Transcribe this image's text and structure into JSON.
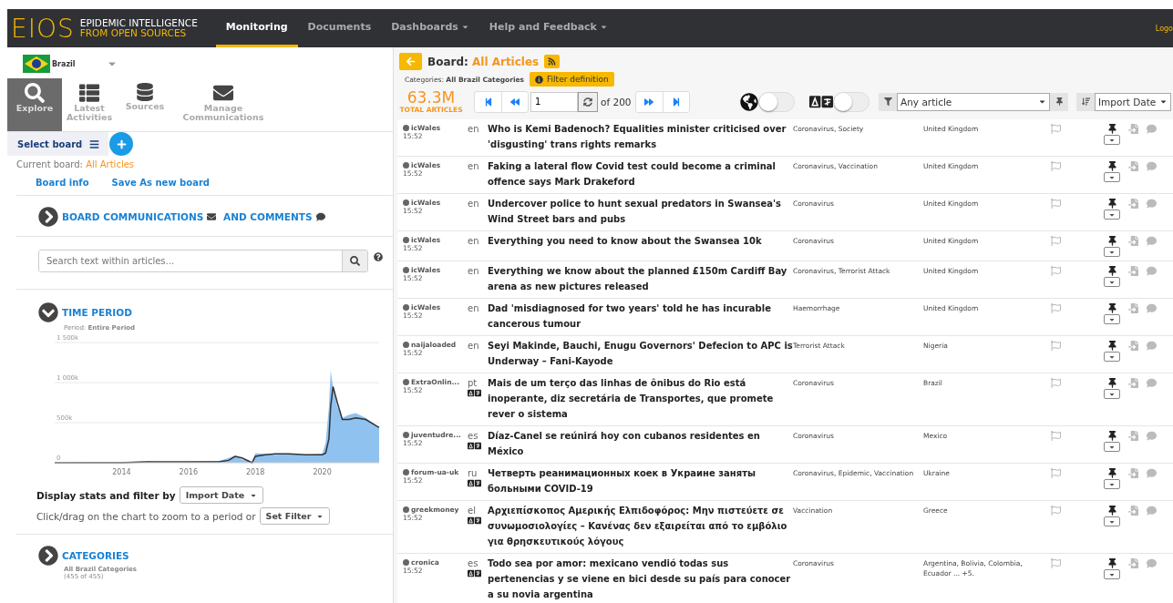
{
  "navbar": {
    "logo": {
      "mark": "EIOS",
      "line1": "EPIDEMIC INTELLIGENCE",
      "line2": "FROM OPEN SOURCES"
    },
    "items": [
      {
        "label": "Monitoring",
        "selected": true,
        "dropdown": false
      },
      {
        "label": "Documents",
        "selected": false,
        "dropdown": false
      },
      {
        "label": "Dashboards",
        "selected": false,
        "dropdown": true
      },
      {
        "label": "Help and Feedback",
        "selected": false,
        "dropdown": true
      }
    ],
    "right_link": "Logo"
  },
  "sidebar": {
    "country": "Brazil",
    "tools": [
      {
        "label": "Explore",
        "selected": true
      },
      {
        "label": "Latest Activities",
        "selected": false
      },
      {
        "label": "Sources",
        "selected": false
      },
      {
        "label": "Manage Communications",
        "selected": false
      }
    ],
    "select_board": "Select board",
    "current_board_label": "Current board:",
    "current_board": "All Articles",
    "links": [
      "Board info",
      "Save As new board"
    ],
    "communications": {
      "title_1": "BOARD COMMUNICATIONS",
      "title_2": "AND COMMENTS",
      "expanded": false
    },
    "search": {
      "placeholder": "Search text within articles..."
    },
    "time_period": {
      "title": "TIME PERIOD",
      "expanded": true,
      "period_label": "Period:",
      "period": "Entire Period",
      "chart_data": {
        "type": "area",
        "xlim": [
          2012,
          2021.7
        ],
        "ylim": [
          0,
          1500000
        ],
        "xticks": [
          2014,
          2016,
          2018,
          2020
        ],
        "yticks": [
          {
            "value": 0,
            "label": "0"
          },
          {
            "value": 500000,
            "label": "500k"
          },
          {
            "value": 1000000,
            "label": "1 000k"
          },
          {
            "value": 1500000,
            "label": "1 500k"
          }
        ],
        "x": [
          2012,
          2013,
          2014,
          2014.8,
          2015,
          2016,
          2016.9,
          2017.2,
          2017.4,
          2017.6,
          2017.8,
          2017.9,
          2018.0,
          2018.3,
          2018.6,
          2019,
          2019.5,
          2020.0,
          2020.1,
          2020.2,
          2020.25,
          2020.32,
          2020.45,
          2020.6,
          2020.8,
          2021.0,
          2021.3,
          2021.7
        ],
        "series": [
          {
            "type": "area",
            "color": "#90c2f0",
            "values": [
              0,
              10000,
              10000,
              20000,
              10000,
              10000,
              20000,
              60000,
              90000,
              40000,
              20000,
              10000,
              120000,
              110000,
              100000,
              110000,
              100000,
              110000,
              250000,
              700000,
              1150000,
              950000,
              700000,
              560000,
              600000,
              620000,
              560000,
              430000
            ]
          },
          {
            "type": "line",
            "color": "#333333",
            "values": [
              0,
              0,
              0,
              10000,
              10000,
              10000,
              10000,
              30000,
              80000,
              60000,
              20000,
              0,
              80000,
              100000,
              110000,
              110000,
              100000,
              100000,
              120000,
              300000,
              700000,
              950000,
              750000,
              540000,
              540000,
              560000,
              540000,
              440000
            ]
          }
        ]
      }
    },
    "display_stats": {
      "label": "Display stats and filter by",
      "value": "Import Date"
    },
    "zoom_hint": "Click/drag on the chart to zoom to a period or",
    "set_filter": "Set Filter",
    "categories": {
      "title": "CATEGORIES",
      "expanded": false,
      "subtitle": "All Brazil Categories",
      "count": "(455 of 455)"
    }
  },
  "board": {
    "label": "Board:",
    "name": "All Articles",
    "categories_label": "Categories:",
    "categories": "All Brazil Categories",
    "filter_button": "Filter definition",
    "total": "63.3M",
    "total_label": "TOTAL ARTICLES",
    "page": "1",
    "page_of": "of 200",
    "map_toggle": {
      "on": false
    },
    "translate_toggle": {
      "on": false
    },
    "article_filter": "Any article",
    "sort": "Import Date"
  },
  "articles": [
    {
      "source": "icWales",
      "time": "15:52",
      "lang": "en",
      "translated": false,
      "title": "Who is Kemi Badenoch? Equalities minister criticised over 'disgusting' trans rights remarks",
      "categories": "Coronavirus, Society",
      "countries": "United Kingdom"
    },
    {
      "source": "icWales",
      "time": "15:52",
      "lang": "en",
      "translated": false,
      "title": "Faking a lateral flow Covid test could become a criminal offence says Mark Drakeford",
      "categories": "Coronavirus, Vaccination",
      "countries": "United Kingdom"
    },
    {
      "source": "icWales",
      "time": "15:52",
      "lang": "en",
      "translated": false,
      "title": "Undercover police to hunt sexual predators in Swansea's Wind Street bars and pubs",
      "categories": "Coronavirus",
      "countries": "United Kingdom"
    },
    {
      "source": "icWales",
      "time": "15:52",
      "lang": "en",
      "translated": false,
      "title": "Everything you need to know about the Swansea 10k",
      "categories": "Coronavirus",
      "countries": "United Kingdom"
    },
    {
      "source": "icWales",
      "time": "15:52",
      "lang": "en",
      "translated": false,
      "title": "Everything we know about the planned £150m Cardiff Bay arena as new pictures released",
      "categories": "Coronavirus, Terrorist Attack",
      "countries": "United Kingdom"
    },
    {
      "source": "icWales",
      "time": "15:52",
      "lang": "en",
      "translated": false,
      "title": "Dad 'misdiagnosed for two years' told he has incurable cancerous tumour",
      "categories": "Haemorrhage",
      "countries": "United Kingdom"
    },
    {
      "source": "naijaloaded",
      "time": "15:52",
      "lang": "en",
      "translated": false,
      "title": "Seyi Makinde, Bauchi, Enugu Governors' Defecion to APC is Underway – Fani-Kayode",
      "categories": "Terrorist Attack",
      "countries": "Nigeria"
    },
    {
      "source": "ExtraOnlin...",
      "time": "15:52",
      "lang": "pt",
      "translated": true,
      "title": "Mais de um terço das linhas de ônibus do Rio está inoperante, diz secretária de Transportes, que promete rever o sistema",
      "categories": "Coronavirus",
      "countries": "Brazil"
    },
    {
      "source": "juventudre...",
      "time": "15:52",
      "lang": "es",
      "translated": true,
      "title": "Díaz-Canel se reúnirá hoy con cubanos residentes en México",
      "categories": "Coronavirus",
      "countries": "Mexico"
    },
    {
      "source": "forum-ua-uk",
      "time": "15:52",
      "lang": "ru",
      "translated": true,
      "title": "Четверть реанимационных коек в Украине заняты больными COVID-19",
      "categories": "Coronavirus, Epidemic, Vaccination",
      "countries": "Ukraine"
    },
    {
      "source": "greekmoney",
      "time": "15:52",
      "lang": "el",
      "translated": true,
      "title": "Αρχιεπίσκοπος Αμερικής Ελπιδοφόρος: Μην πιστεύετε σε συνωμοσιολογίες – Κανένας δεν εξαιρείται από το εμβόλιο για θρησκευτικούς λόγους",
      "categories": "Vaccination",
      "countries": "Greece"
    },
    {
      "source": "cronica",
      "time": "15:52",
      "lang": "es",
      "translated": true,
      "title": "Todo sea por amor: mexicano vendió todas sus pertenencias y se viene en bici desde su país para conocer a su novia argentina",
      "categories": "Coronavirus",
      "countries": "Argentina, Bolivia, Colombia, Ecuador ... +5."
    }
  ]
}
